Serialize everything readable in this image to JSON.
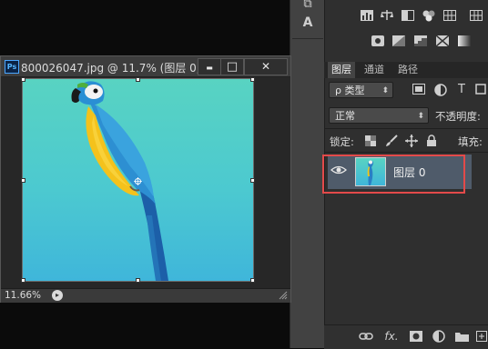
{
  "tool_strip": {
    "icons": [
      "layers-stack-icon",
      "text-tool-icon"
    ],
    "glyphs": [
      "⧉",
      "A"
    ]
  },
  "adjustments": {
    "row1": [
      "levels-icon",
      "balance-icon",
      "halfrect-icon",
      "color-balance-icon",
      "grid-icon"
    ],
    "row2": [
      "photo-filter-icon",
      "gradient-icon",
      "posterize-icon",
      "threshold-icon",
      "gradient-map-icon"
    ]
  },
  "document": {
    "ps_badge": "Ps",
    "title": "800026047.jpg @ 11.7% (图层 0, ...",
    "minimize": "▬",
    "restore": "□",
    "close": "✕",
    "zoom": "11.66%",
    "status_arrow": "▸"
  },
  "layers_panel": {
    "tabs": [
      "图层",
      "通道",
      "路径"
    ],
    "active_tab": "图层",
    "filter_label": "ρ 类型",
    "blend_mode": "正常",
    "opacity_label": "不透明度:",
    "lock_label": "锁定:",
    "fill_label": "填充:",
    "layer_name": "图层 0"
  },
  "bottom_bar": {
    "icons": [
      "link-icon",
      "fx-icon",
      "mask-icon",
      "adjustment-layer-icon",
      "folder-icon",
      "new-layer-icon"
    ],
    "fx_label": "fx."
  },
  "colors": {
    "canvas_top": "#58d3c2",
    "canvas_bottom": "#3fb6da",
    "highlight": "#e34a4a",
    "selected_layer": "#4f5b6a"
  }
}
